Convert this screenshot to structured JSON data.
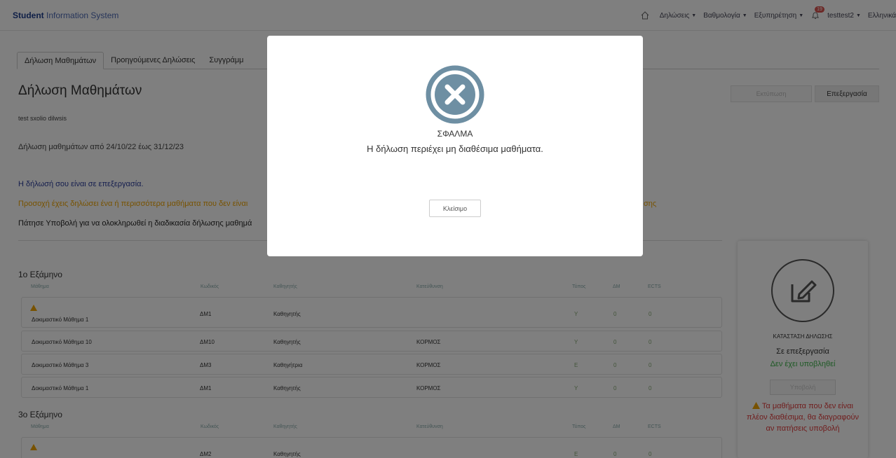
{
  "navbar": {
    "brand_bold": "Student",
    "brand_rest": "Information System",
    "items": [
      "Δηλώσεις",
      "Βαθμολογία",
      "Εξυπηρέτηση"
    ],
    "notification_count": "19",
    "user": "testtest2",
    "language": "Ελληνικά"
  },
  "tabs": [
    "Δήλωση Μαθημάτων",
    "Προηγούμενες Δηλώσεις",
    "Συγγράμμ"
  ],
  "page": {
    "title": "Δήλωση Μαθημάτων",
    "print_button": "Εκτύπωση",
    "edit_button": "Επεξεργασία",
    "school": "test sxolio dilwsis",
    "period": "Δήλωση μαθημάτων από 24/10/22 έως 31/12/23",
    "status_message": "Η δήλωσή σου είναι σε επεξεργασία.",
    "warning_message": "Προσοχή έχεις δηλώσει ένα ή περισσότερα μαθήματα που δεν είναι",
    "warning_tail": "σης",
    "hint_message": "Πάτησε Υποβολή για να ολοκληρωθεί η διαδικασία δήλωσης μαθημά"
  },
  "columns": {
    "course": "Μάθημα",
    "code": "Κωδικός",
    "professor": "Καθηγητής",
    "direction": "Κατεύθυνση",
    "type": "Τύπος",
    "dm": "ΔΜ",
    "ects": "ECTS"
  },
  "semester1": {
    "title": "1ο Εξάμηνο",
    "rows": [
      {
        "course": "Δοκιμαστικό Μάθημα 1",
        "code": "ΔΜ1",
        "professor": "Καθηγητής",
        "direction": "",
        "type": "Y",
        "dm": "0",
        "ects": "0",
        "warning": true
      },
      {
        "course": "Δοκιμαστικό Μάθημα 10",
        "code": "ΔΜ10",
        "professor": "Καθηγητής",
        "direction": "ΚΟΡΜΟΣ",
        "type": "Y",
        "dm": "0",
        "ects": "0",
        "warning": false
      },
      {
        "course": "Δοκιμαστικό Μάθημα 3",
        "code": "ΔΜ3",
        "professor": "Καθηγήτρια",
        "direction": "ΚΟΡΜΟΣ",
        "type": "E",
        "dm": "0",
        "ects": "0",
        "warning": false
      },
      {
        "course": "Δοκιμαστικό Μάθημα 1",
        "code": "ΔΜ1",
        "professor": "Καθηγητής",
        "direction": "ΚΟΡΜΟΣ",
        "type": "Y",
        "dm": "0",
        "ects": "0",
        "warning": false
      }
    ]
  },
  "semester3": {
    "title": "3ο Εξάμηνο",
    "rows": [
      {
        "course": "",
        "code": "ΔΜ2",
        "professor": "Καθηγητής",
        "direction": "",
        "type": "E",
        "dm": "0",
        "ects": "0",
        "warning": true
      }
    ]
  },
  "side": {
    "label": "ΚΑΤΑΣΤΑΣΗ ΔΗΛΩΣΗΣ",
    "state": "Σε επεξεργασία",
    "submitted": "Δεν έχει υποβληθεί",
    "submit_button": "Υποβολή",
    "warning": "Τα μαθήματα που δεν είναι πλέον διαθέσιμα, θα διαγραφούν αν πατήσεις υποβολή"
  },
  "modal": {
    "title": "ΣΦΑΛΜΑ",
    "message": "Η δήλωση περιέχει μη διαθέσιμα μαθήματα.",
    "close_button": "Κλείσιμο"
  },
  "colors": {
    "brand": "#1f3f8f",
    "status_blue": "#2a3c9c",
    "warning_orange": "#f0a500",
    "error_red": "#e03a3a",
    "submitted_green": "#3db34a",
    "modal_icon": "#6e8fa3"
  },
  "icons": [
    "home-icon",
    "bell-icon",
    "warning-icon",
    "edit-icon",
    "close-circle-icon"
  ]
}
